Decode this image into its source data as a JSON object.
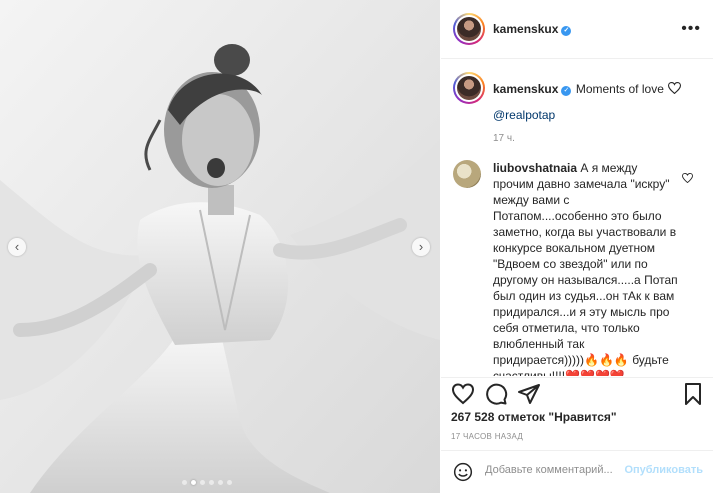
{
  "header": {
    "username": "kamenskux",
    "more_label": "•••"
  },
  "caption": {
    "username": "kamenskux",
    "text": "Moments of love",
    "mention": "@realpotap",
    "time": "17 ч."
  },
  "comment": {
    "username": "liubovshatnaia",
    "lines": [
      "А я между",
      "прочим давно замечала \"искру\"",
      "между вами с",
      "Потапом....особенно это было",
      "заметно, когда вы участвовали в",
      "конкурсе вокальном дуетном",
      "\"Вдвоем со звездой\" или по",
      "другому он назывался.....а Потап",
      "был один из судья...он тАк к вам",
      "придирался...и я эту мысль про",
      "себя отметила, что только",
      "влюбленный так",
      "придирается)))))🔥🔥🔥 будьте",
      "счастливы!!!!❤️❤️❤️❤️"
    ]
  },
  "likes": {
    "text": "267 528 отметок \"Нравится\""
  },
  "time_ago": "17 ЧАСОВ НАЗАД",
  "add_comment": {
    "placeholder": "Добавьте комментарий...",
    "post_label": "Опубликовать"
  },
  "carousel": {
    "slide_count": 6,
    "active_index": 1,
    "prev": "‹",
    "next": "›"
  },
  "colors": {
    "link": "#00376b",
    "verified": "#3897f0",
    "post_button": "#b2dffc"
  }
}
